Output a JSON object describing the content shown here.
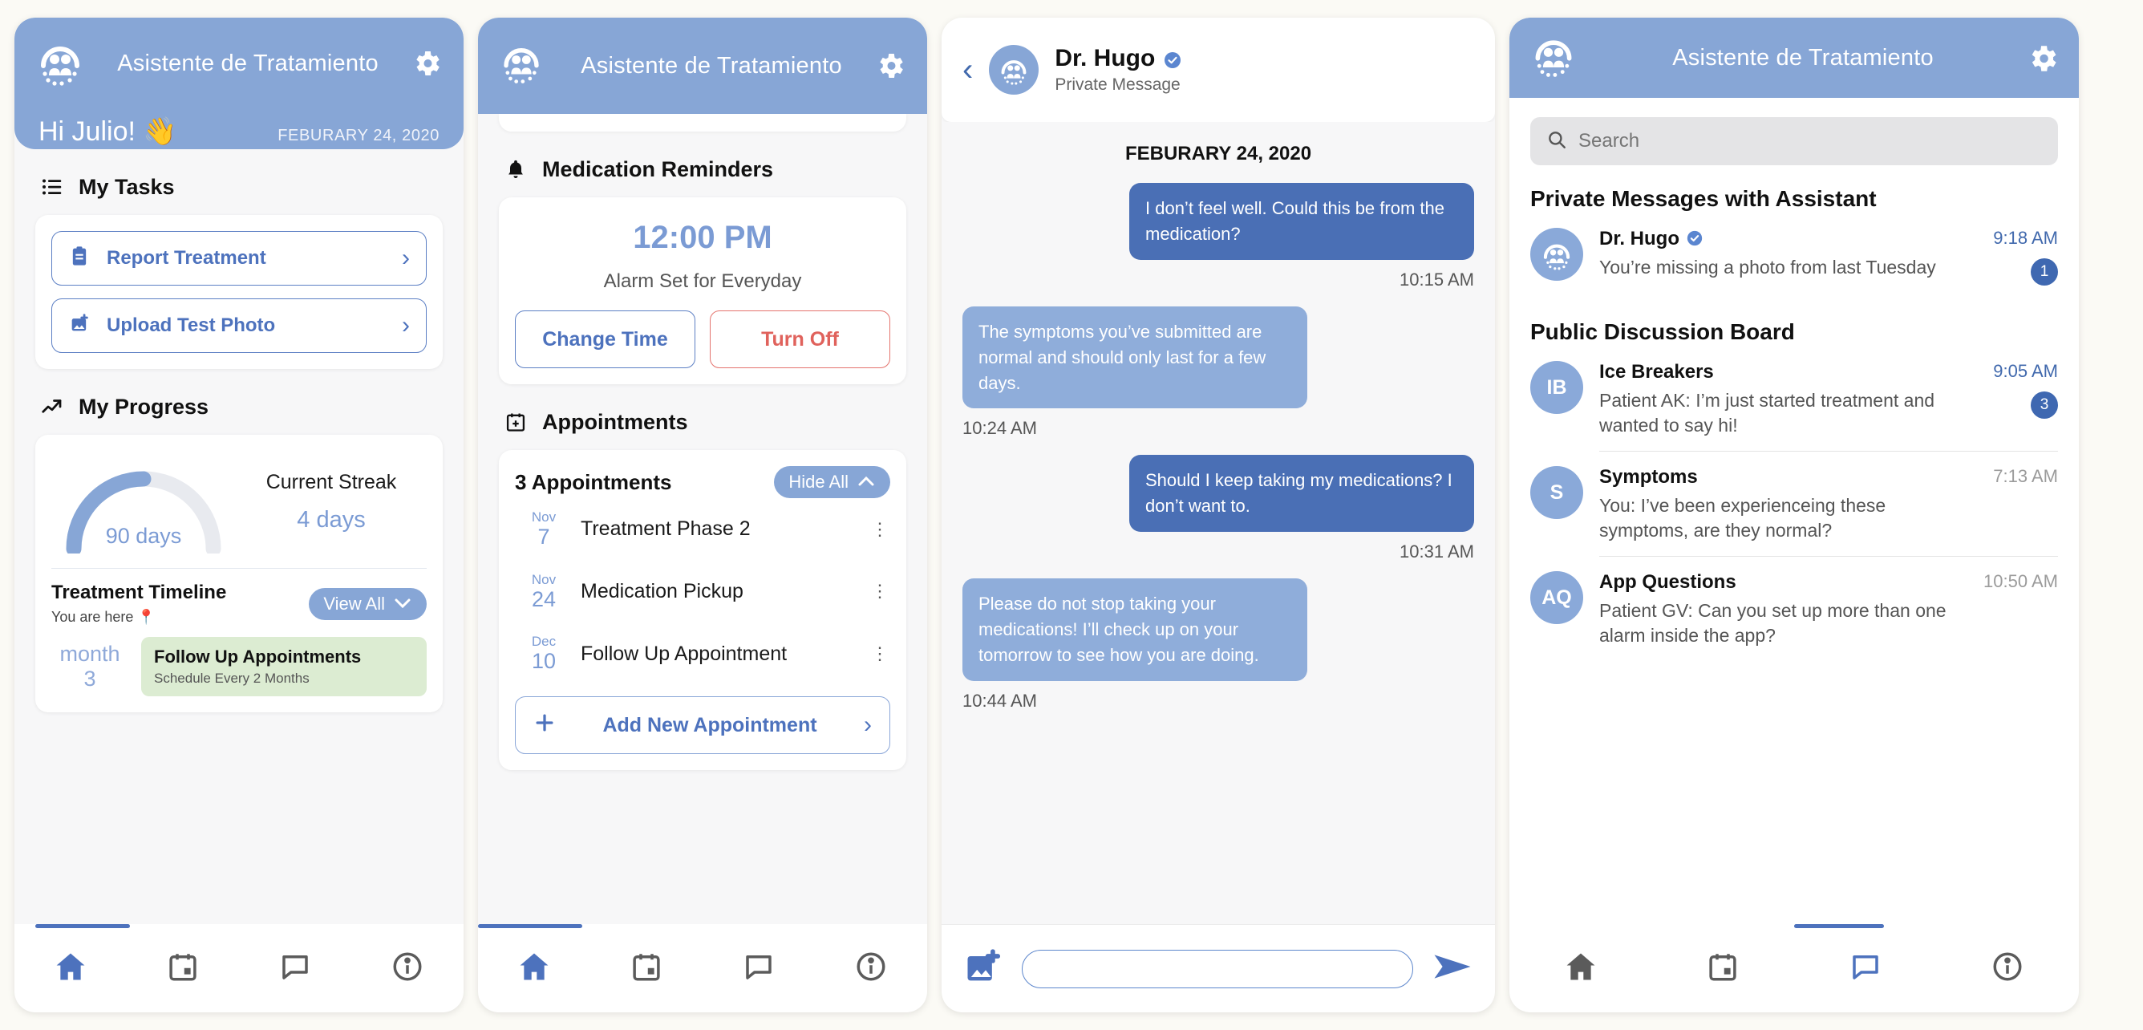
{
  "app": {
    "title": "Asistente de Tratamiento",
    "logo_icon": "people-circle-logo",
    "gear_icon": "gear-icon",
    "accent": "#87a6d6",
    "accent_dark": "#4a6fb5",
    "green_chip": "#dcecd2",
    "red": "#e0625c"
  },
  "screen_home": {
    "greeting": "Hi Julio! 👋",
    "date": "FEBURARY 24, 2020",
    "tasks": {
      "section_icon": "list-icon",
      "section_title": "My Tasks",
      "items": [
        {
          "label": "Report Treatment",
          "icon": "clipboard-icon",
          "chevron": "›"
        },
        {
          "label": "Upload Test Photo",
          "icon": "add-photo-icon",
          "chevron": "›"
        }
      ]
    },
    "progress": {
      "section_icon": "trending-up-icon",
      "section_title": "My Progress",
      "gauge_label": "90 days",
      "gauge_percent": 50,
      "streak_title": "Current Streak",
      "streak_value": "4 days",
      "timeline_title": "Treatment Timeline",
      "view_all_label": "View All",
      "view_all_icon": "chevron-down-icon",
      "you_are_here": "You are here 📍",
      "month_label": "month",
      "month_value": "3",
      "chip_title": "Follow Up Appointments",
      "chip_sub": "Schedule Every 2 Months"
    },
    "nav": {
      "active_index": 0,
      "items": [
        "home-icon",
        "calendar-icon",
        "chat-icon",
        "info-icon"
      ]
    }
  },
  "screen_meds": {
    "medication": {
      "section_icon": "bell-icon",
      "section_title": "Medication Reminders",
      "time": "12:00 PM",
      "subtitle": "Alarm Set for Everyday",
      "change_label": "Change Time",
      "turnoff_label": "Turn Off"
    },
    "appointments": {
      "section_icon": "calendar-plus-icon",
      "section_title": "Appointments",
      "count_label": "3 Appointments",
      "hide_all_label": "Hide All",
      "hide_all_icon": "chevron-up-icon",
      "rows": [
        {
          "month": "Nov",
          "day": "7",
          "name": "Treatment Phase 2",
          "menu_icon": "kebab-menu-icon"
        },
        {
          "month": "Nov",
          "day": "24",
          "name": "Medication Pickup",
          "menu_icon": "kebab-menu-icon"
        },
        {
          "month": "Dec",
          "day": "10",
          "name": "Follow Up Appointment",
          "menu_icon": "kebab-menu-icon"
        }
      ],
      "add_label": "Add New Appointment",
      "add_icon": "plus-icon",
      "add_chevron": "›"
    },
    "nav": {
      "active_index": 0,
      "items": [
        "home-icon",
        "calendar-icon",
        "chat-icon",
        "info-icon"
      ]
    }
  },
  "screen_chat": {
    "back_icon": "back-chevron-icon",
    "name": "Dr. Hugo",
    "verified_icon": "verified-badge-icon",
    "subtitle": "Private Message",
    "date": "FEBURARY 24, 2020",
    "messages": [
      {
        "side": "out",
        "text": "I don’t feel well. Could this be from the medication?",
        "time": "10:15 AM"
      },
      {
        "side": "in",
        "text": "The symptoms you’ve submitted are normal and should only last for a few days.",
        "time": "10:24 AM"
      },
      {
        "side": "out",
        "text": "Should I keep taking my medications? I don’t want to.",
        "time": "10:31 AM"
      },
      {
        "side": "in",
        "text": "Please do not stop taking your medications! I’ll check up on your tomorrow to see how you are doing.",
        "time": "10:44 AM"
      }
    ],
    "composer": {
      "attach_icon": "add-image-icon",
      "input_value": "",
      "input_placeholder": "",
      "send_icon": "send-icon"
    }
  },
  "screen_messages": {
    "search": {
      "icon": "search-icon",
      "placeholder": "Search",
      "value": ""
    },
    "private_section": "Private Messages with Assistant",
    "private_items": [
      {
        "avatar_type": "logo",
        "avatar_text": "",
        "name": "Dr. Hugo",
        "verified_icon": "verified-badge-icon",
        "preview": "You’re missing a photo from last Tuesday",
        "time": "9:18 AM",
        "time_color": "blue",
        "badge": "1"
      }
    ],
    "public_section": "Public Discussion Board",
    "public_items": [
      {
        "avatar_type": "initials",
        "avatar_text": "IB",
        "name": "Ice Breakers",
        "preview": "Patient AK: I’m just started treatment and wanted to say hi!",
        "time": "9:05 AM",
        "time_color": "blue",
        "badge": "3"
      },
      {
        "avatar_type": "initials",
        "avatar_text": "S",
        "name": "Symptoms",
        "preview": "You: I’ve been experienceing these symptoms, are they normal?",
        "time": "7:13 AM",
        "time_color": "gray",
        "badge": ""
      },
      {
        "avatar_type": "initials",
        "avatar_text": "AQ",
        "name": "App Questions",
        "preview": "Patient GV: Can you set up more than one alarm inside the app?",
        "time": "10:50 AM",
        "time_color": "gray",
        "badge": ""
      }
    ],
    "nav": {
      "active_index": 2,
      "items": [
        "home-icon",
        "calendar-icon",
        "chat-icon",
        "info-icon"
      ]
    }
  }
}
